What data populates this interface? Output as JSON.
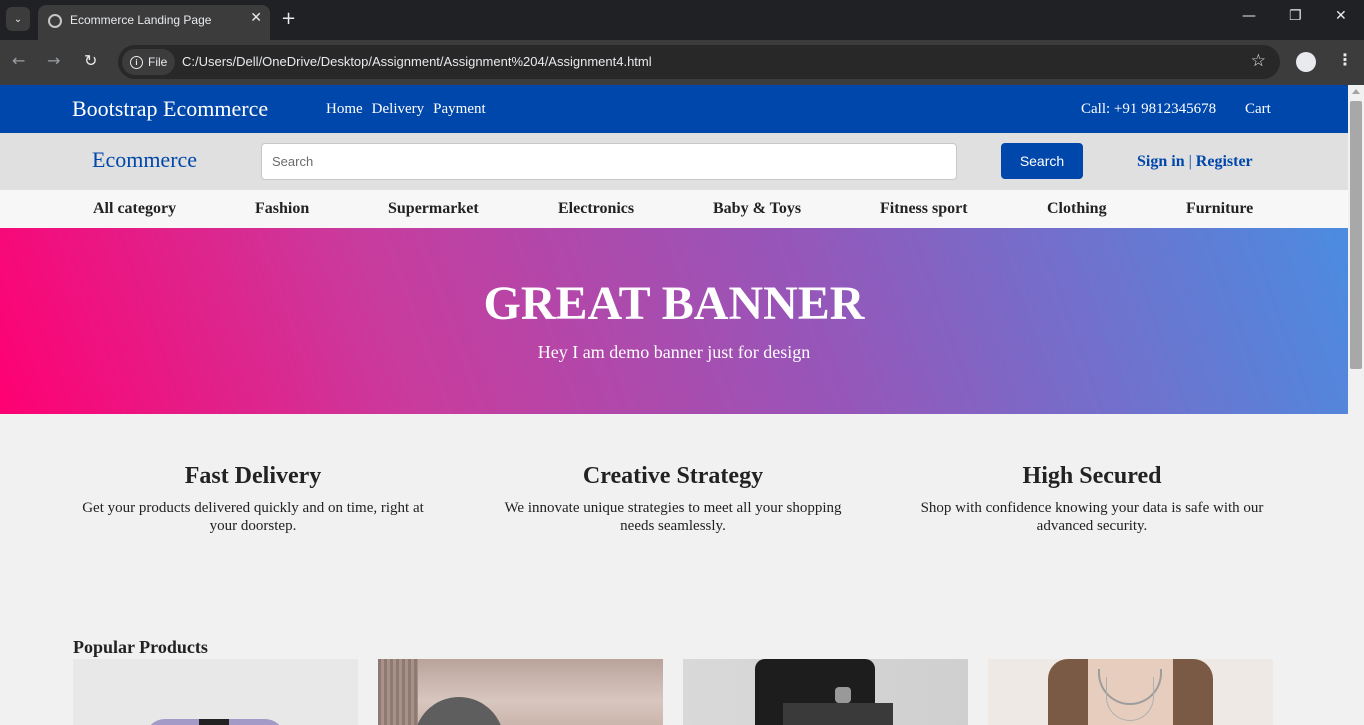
{
  "browser": {
    "tab_title": "Ecommerce Landing Page",
    "address_chip": "File",
    "url": "C:/Users/Dell/OneDrive/Desktop/Assignment/Assignment%204/Assignment4.html"
  },
  "topbar": {
    "brand": "Bootstrap Ecommerce",
    "nav": [
      "Home",
      "Delivery",
      "Payment"
    ],
    "call": "Call: +91 9812345678",
    "cart": "Cart"
  },
  "searchbar": {
    "logo": "Ecommerce",
    "placeholder": "Search",
    "button": "Search",
    "sign_in": "Sign in",
    "separator": "|",
    "register": "Register"
  },
  "categories": [
    "All category",
    "Fashion",
    "Supermarket",
    "Electronics",
    "Baby & Toys",
    "Fitness sport",
    "Clothing",
    "Furniture"
  ],
  "banner": {
    "title": "GREAT BANNER",
    "subtitle": "Hey I am demo banner just for design",
    "colors": [
      "#ff0072",
      "#c83c9e",
      "#9656b9",
      "#4b8ce0"
    ]
  },
  "features": [
    {
      "title": "Fast Delivery",
      "text": "Get your products delivered quickly and on time, right at your doorstep."
    },
    {
      "title": "Creative Strategy",
      "text": "We innovate unique strategies to meet all your shopping needs seamlessly."
    },
    {
      "title": "High Secured",
      "text": "Shop with confidence knowing your data is safe with our advanced security."
    }
  ],
  "products": {
    "title": "Popular Products"
  },
  "colors": {
    "primary": "#0047ab"
  }
}
